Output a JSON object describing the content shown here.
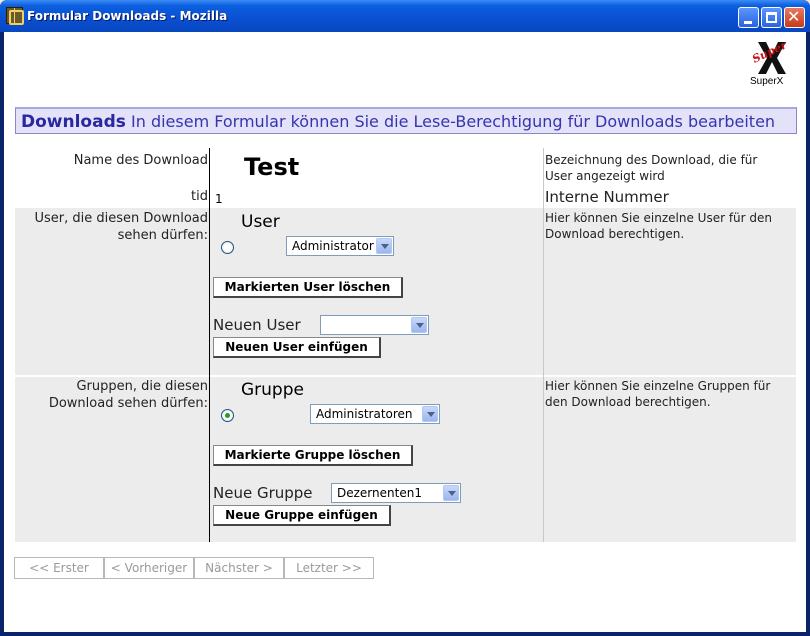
{
  "window": {
    "title": "Formular Downloads - Mozilla"
  },
  "logo": {
    "label": "SuperX",
    "mark_text": "Super"
  },
  "header": {
    "title": "Downloads",
    "description": "In diesem Formular können Sie die Lese-Berechtigung für Downloads bearbeiten"
  },
  "rows": {
    "name": {
      "label": "Name des Download",
      "value": "Test",
      "description_line1": "Bezeichnung des Download, die für",
      "description_line2": "User angezeigt wird"
    },
    "tid": {
      "label": "tid",
      "value": "1",
      "description": "Interne Nummer"
    },
    "user": {
      "label_line1": "User, die diesen Download",
      "label_line2": "sehen dürfen:",
      "heading": "User",
      "selected": "Administrator",
      "delete_button": "Markierten User löschen",
      "new_label": "Neuen User",
      "new_value": "",
      "add_button": "Neuen User einfügen",
      "description_line1": "Hier können Sie einzelne User für den",
      "description_line2": "Download berechtigen."
    },
    "group": {
      "label_line1": "Gruppen, die diesen",
      "label_line2": "Download sehen dürfen:",
      "heading": "Gruppe",
      "selected": "Administratoren",
      "delete_button": "Markierte Gruppe löschen",
      "new_label": "Neue Gruppe",
      "new_value": "Dezernenten1",
      "add_button": "Neue Gruppe einfügen",
      "description_line1": "Hier können Sie einzelne Gruppen für",
      "description_line2": "den Download berechtigen."
    }
  },
  "pagination": {
    "first": "<< Erster",
    "prev": "< Vorheriger",
    "next": "Nächster >",
    "last": "Letzter >>"
  },
  "colors": {
    "header_text": "#2a28a0",
    "header_bg": "#e4e2f8",
    "row_bg": "#ececec"
  }
}
